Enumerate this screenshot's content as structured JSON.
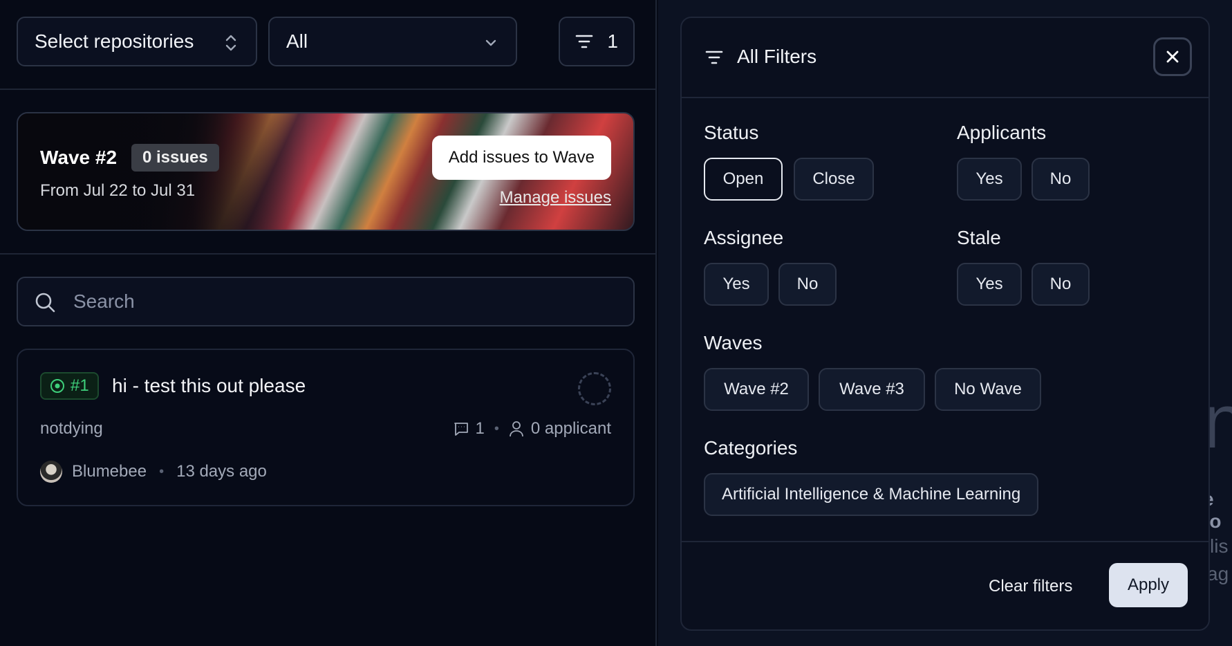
{
  "toolbar": {
    "repo_select": "Select repositories",
    "type_select": "All",
    "filter_count": "1"
  },
  "wave": {
    "title": "Wave #2",
    "badge": "0 issues",
    "dates": "From Jul 22 to Jul 31",
    "add_button": "Add issues to Wave",
    "manage_link": "Manage issues"
  },
  "search": {
    "placeholder": "Search"
  },
  "issue": {
    "number": "#1",
    "title": "hi - test this out please",
    "repo": "notdying",
    "comments": "1",
    "applicants": "0 applicant",
    "author": "Blumebee",
    "time": "13 days ago"
  },
  "filters": {
    "title": "All Filters",
    "status_label": "Status",
    "status_open": "Open",
    "status_close": "Close",
    "applicants_label": "Applicants",
    "applicants_yes": "Yes",
    "applicants_no": "No",
    "assignee_label": "Assignee",
    "assignee_yes": "Yes",
    "assignee_no": "No",
    "stale_label": "Stale",
    "stale_yes": "Yes",
    "stale_no": "No",
    "waves_label": "Waves",
    "wave_2": "Wave #2",
    "wave_3": "Wave #3",
    "no_wave": "No Wave",
    "categories_label": "Categories",
    "category_1": "Artificial Intelligence & Machine Learning",
    "clear_button": "Clear filters",
    "apply_button": "Apply"
  },
  "background_fragments": {
    "frag_1": "e to",
    "frag_2": "lis",
    "frag_3": "ag"
  },
  "colors": {
    "accent_green": "#3ecf7a",
    "panel_bg": "#0a0f1e",
    "page_bg": "#060a16"
  }
}
